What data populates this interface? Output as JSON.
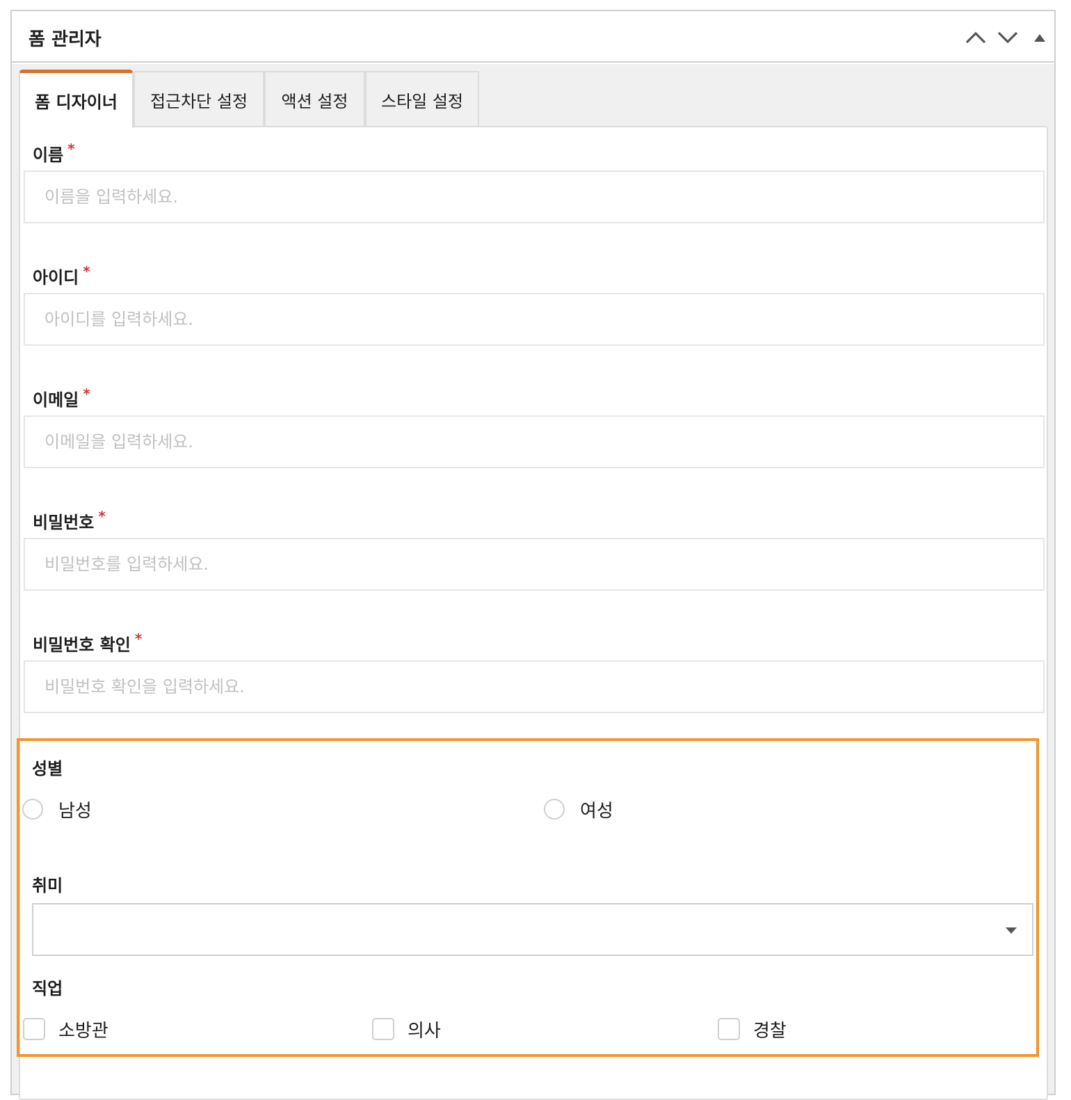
{
  "panel": {
    "title": "폼 관리자",
    "buttons": [
      "move-up",
      "move-down",
      "collapse"
    ]
  },
  "tabs": [
    {
      "label": "폼 디자이너",
      "active": true
    },
    {
      "label": "접근차단 설정",
      "active": false
    },
    {
      "label": "액션 설정",
      "active": false
    },
    {
      "label": "스타일 설정",
      "active": false
    }
  ],
  "accent_color": "#d4722a",
  "highlight_color": "#f0962e",
  "required_mark": "*",
  "fields": {
    "name": {
      "label": "이름",
      "placeholder": "이름을 입력하세요."
    },
    "userid": {
      "label": "아이디",
      "placeholder": "아이디를 입력하세요."
    },
    "email": {
      "label": "이메일",
      "placeholder": "이메일을 입력하세요."
    },
    "password": {
      "label": "비밀번호",
      "placeholder": "비밀번호를 입력하세요."
    },
    "password_confirm": {
      "label": "비밀번호 확인",
      "placeholder": "비밀번호 확인을 입력하세요."
    }
  },
  "gender": {
    "label": "성별",
    "options": [
      "남성",
      "여성"
    ]
  },
  "hobby": {
    "label": "취미",
    "selected": ""
  },
  "job": {
    "label": "직업",
    "options": [
      "소방관",
      "의사",
      "경찰"
    ]
  }
}
